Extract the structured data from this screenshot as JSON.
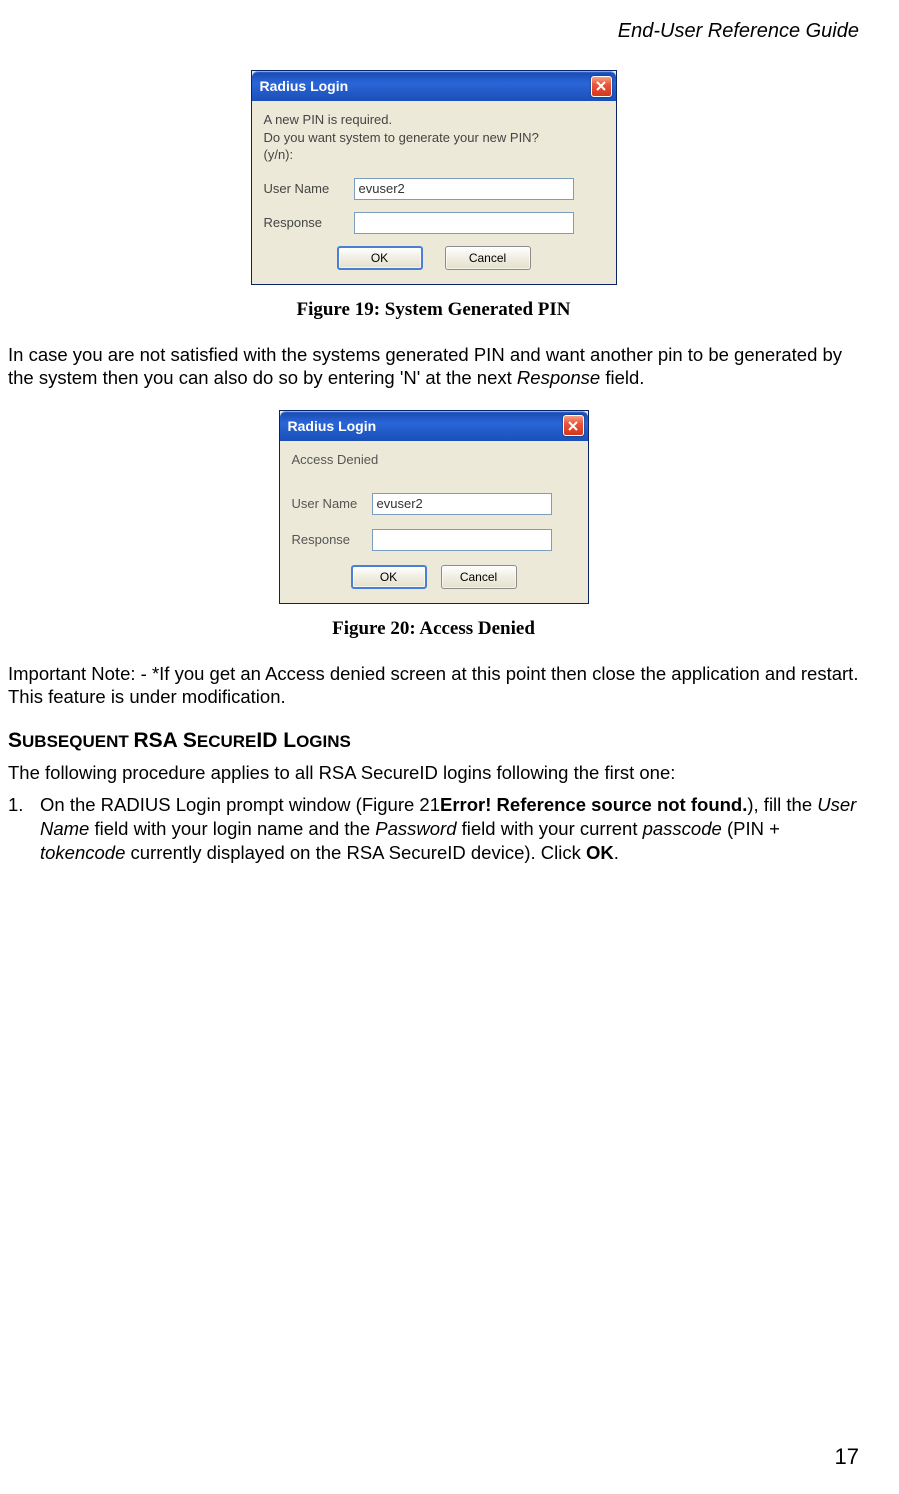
{
  "header": {
    "title": "End-User Reference Guide"
  },
  "dialog1": {
    "title": "Radius Login",
    "message_line1": "A new PIN is required.",
    "message_line2": "Do you want system to generate your new PIN?",
    "message_line3": "(y/n):",
    "labels": {
      "user": "User Name",
      "response": "Response"
    },
    "values": {
      "user": "evuser2",
      "response": ""
    },
    "buttons": {
      "ok": "OK",
      "cancel": "Cancel"
    }
  },
  "fig19": "Figure 19: System Generated PIN",
  "para1_a": "In case you are not satisfied with the systems generated PIN and want another pin to be generated by the system then you can also do so by entering 'N' at the next ",
  "para1_it": "Response",
  "para1_b": " field.",
  "dialog2": {
    "title": "Radius Login",
    "message": "Access Denied",
    "labels": {
      "user": "User Name",
      "response": "Response"
    },
    "values": {
      "user": "evuser2",
      "response": ""
    },
    "buttons": {
      "ok": "OK",
      "cancel": "Cancel"
    }
  },
  "fig20": "Figure 20: Access Denied",
  "para2": "Important Note: - *If you get an Access denied screen at this point then close the application and restart. This feature is under modification.",
  "heading": {
    "s1": "S",
    "ubseq": "UBSEQUENT ",
    "rsa": "RSA S",
    "ecure": "ECURE",
    "id": "ID ",
    "l": "L",
    "ogins": "OGINS"
  },
  "para3": "The following procedure applies to all RSA SecureID logins following the first one:",
  "list1": {
    "num": "1.",
    "a": "On the RADIUS Login prompt window (Figure 21",
    "bd1": "Error! Reference source not found.",
    "b": "), fill the ",
    "it1": "User Name",
    "c": " field with your login name and the ",
    "it2": "Password",
    "d": " field with your current ",
    "it3": "passcode",
    "e": " (PIN + ",
    "it4": "tokencode",
    "f": " currently displayed on the RSA SecureID device). Click ",
    "bd2": "OK",
    "g": "."
  },
  "pageNumber": "17"
}
